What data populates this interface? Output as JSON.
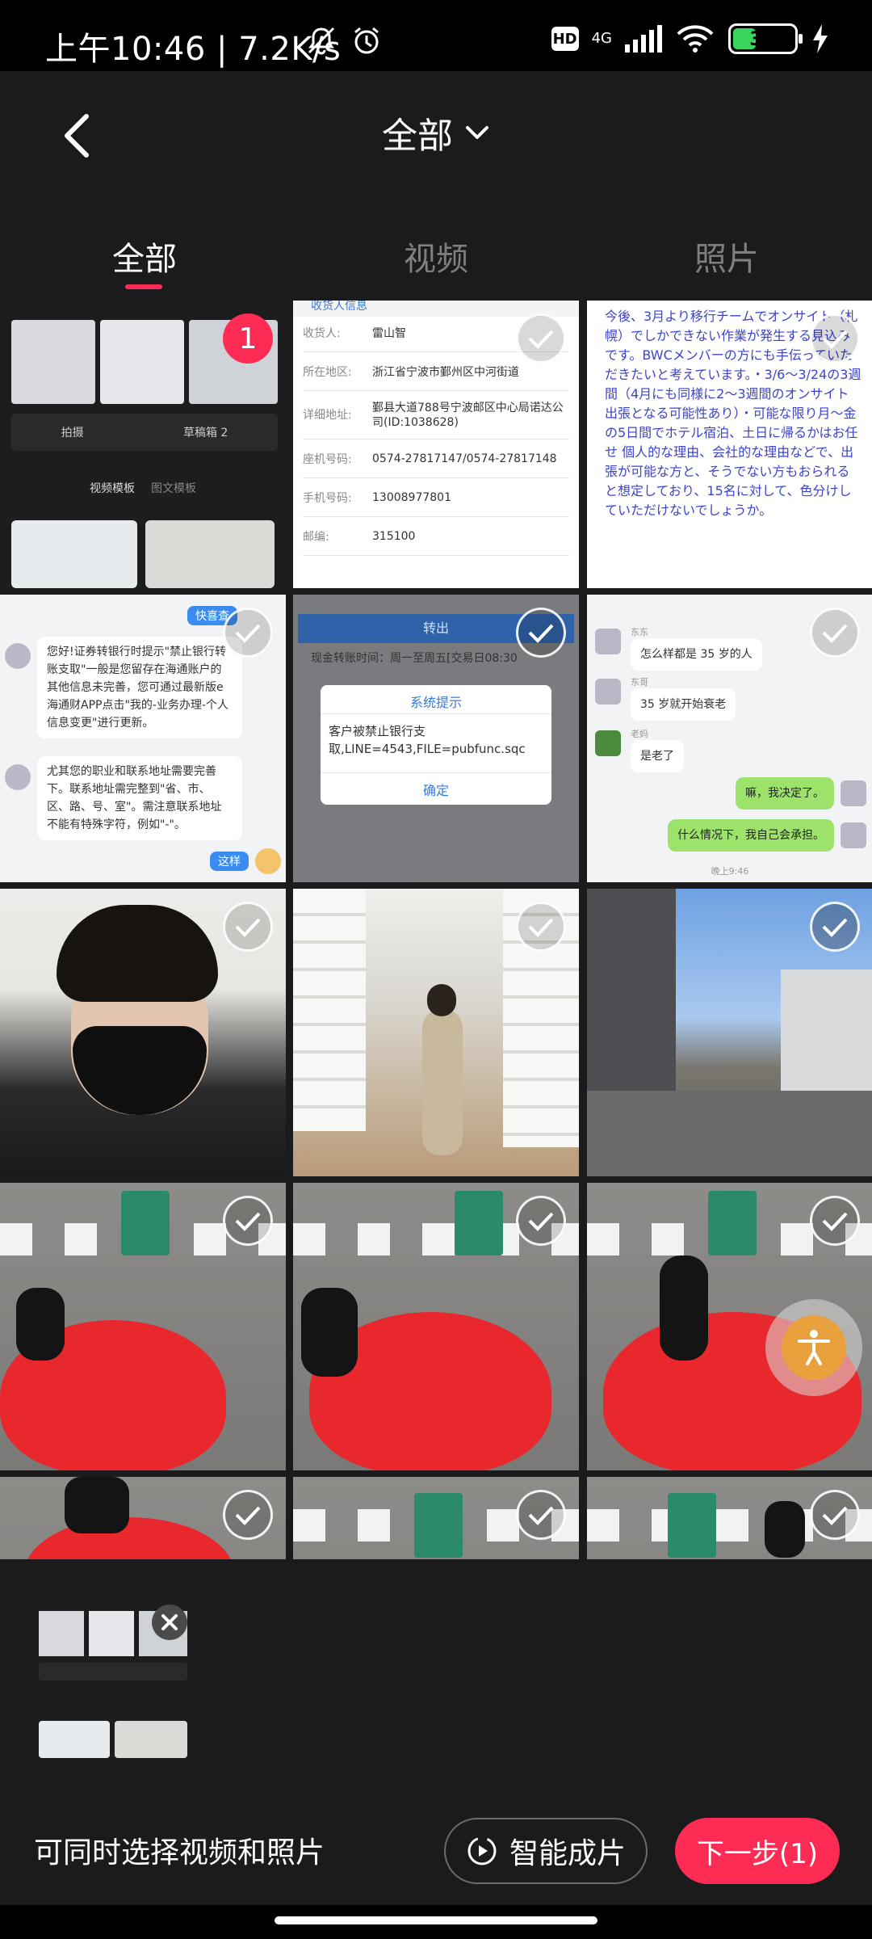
{
  "status_bar": {
    "time": "上午10:46",
    "speed": "7.2K/s",
    "hd": "HD",
    "network": "4G",
    "battery": "38",
    "battery_fraction": 0.38
  },
  "header": {
    "title": "全部"
  },
  "tabs": [
    {
      "label": "全部",
      "active": true
    },
    {
      "label": "视频",
      "active": false
    },
    {
      "label": "照片",
      "active": false
    }
  ],
  "grid": {
    "selected_count_badge": "1",
    "cells": {
      "c1": {
        "tab_a": "拍摄",
        "tab_b": "草稿箱 2",
        "sub_a": "视频模板",
        "sub_b": "图文模板"
      },
      "c2": {
        "header": "收货人信息",
        "rows": [
          {
            "k": "收货人:",
            "v": "雷山智"
          },
          {
            "k": "所在地区:",
            "v": "浙江省宁波市鄞州区中河街道"
          },
          {
            "k": "详细地址:",
            "v": "鄞县大道788号宁波邮区中心局诺达公司(ID:1038628)"
          },
          {
            "k": "座机号码:",
            "v": "0574-27817147/0574-27817148"
          },
          {
            "k": "手机号码:",
            "v": "13008977801"
          },
          {
            "k": "邮编:",
            "v": "315100"
          }
        ]
      },
      "c3": {
        "text": "今後、3月より移行チームでオンサイト（札幌）でしかできない作業が発生する見込みです。BWCメンバーの方にも手伝っていただきたいと考えています。・3/6〜3/24の3週間（4月にも同様に2〜3週間のオンサイト出張となる可能性あり）・可能な限り月〜金の5日間でホテル宿泊、土日に帰るかはお任せ 個人的な理由、会社的な理由などで、出張が可能な方と、そうでない方もおられると想定しており、15名に対して、色分けしていただけないでしょうか。"
      },
      "c4": {
        "top_btn": "快喜查",
        "msg1": "您好!证券转银行时提示\"禁止银行转账支取\"一般是您留存在海通账户的其他信息未完善，您可通过最新版e海通财APP点击\"我的-业务办理-个人信息变更\"进行更新。",
        "msg2": "尤其您的职业和联系地址需要完善下。联系地址需完整到\"省、市、区、路、号、室\"。需注意联系地址不能有特殊字符，例如\"-\"。",
        "reply": "这样"
      },
      "c5": {
        "top_btn": "转出",
        "note": "现金转账时间：周一至周五[交易日08:30",
        "dialog_title": "系统提示",
        "dialog_body": "客户被禁止银行支取,LINE=4543,FILE=pubfunc.sqc",
        "dialog_ok": "确定"
      },
      "c6": {
        "n1": "东东",
        "m1": "怎么样都是 35 岁的人",
        "n2": "东哥",
        "m2": "35 岁就开始衰老",
        "n3": "老妈",
        "m3": "是老了",
        "m4": "嘛，我决定了。",
        "m5": "什么情况下，我自己会承担。",
        "time": "晚上9:46"
      }
    }
  },
  "tray": {},
  "bottom": {
    "hint": "可同时选择视频和照片",
    "smart_button": "智能成片",
    "next_button": "下一步(1)"
  },
  "colors": {
    "accent": "#fe2c55",
    "background": "#1b1b1d"
  }
}
